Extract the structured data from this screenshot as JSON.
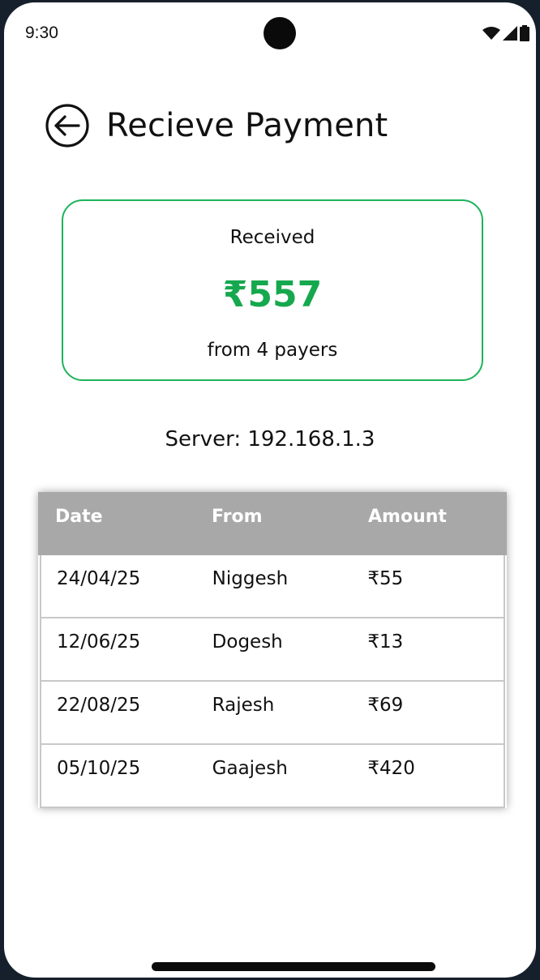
{
  "status_bar": {
    "time": "9:30",
    "icons": [
      "wifi-icon",
      "cellular-signal-icon",
      "battery-icon"
    ]
  },
  "header": {
    "back_icon": "arrow-left-circle-icon",
    "title": "Recieve Payment"
  },
  "summary": {
    "label": "Received",
    "amount": "₹557",
    "subtitle": "from 4 payers"
  },
  "server": {
    "text": "Server: 192.168.1.3"
  },
  "table": {
    "headers": {
      "date": "Date",
      "from": "From",
      "amount": "Amount"
    },
    "rows": [
      {
        "date": "24/04/25",
        "from": "Niggesh",
        "amount": "₹55"
      },
      {
        "date": "12/06/25",
        "from": "Dogesh",
        "amount": "₹13"
      },
      {
        "date": "22/08/25",
        "from": "Rajesh",
        "amount": "₹69"
      },
      {
        "date": "05/10/25",
        "from": "Gaajesh",
        "amount": "₹420"
      }
    ]
  },
  "colors": {
    "accent_green": "#16a84e",
    "card_border": "#1db35a",
    "table_header_bg": "#a8a8a8"
  }
}
